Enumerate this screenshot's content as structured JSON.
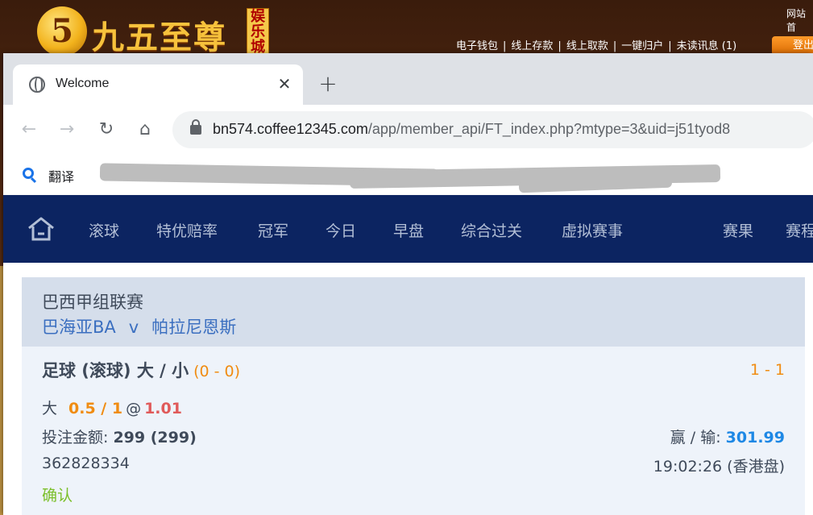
{
  "background_site": {
    "logo_glyph": "5",
    "title": "九五至尊",
    "badge": "娱乐城",
    "links": [
      "电子钱包",
      "线上存款",
      "线上取款",
      "一键归户",
      "未读讯息 (1)"
    ],
    "corner_text": "网站首",
    "login_label": "登出"
  },
  "browser": {
    "tab_title": "Welcome",
    "close_glyph": "✕",
    "new_tab_glyph": "+",
    "url_host": "bn574.coffee12345.com",
    "url_path": "/app/member_api/FT_index.php?mtype=3&uid=j51tyod8",
    "bookmark_label": "翻译"
  },
  "sport_nav": {
    "items": [
      "滚球",
      "特优赔率",
      "冠军",
      "今日",
      "早盘",
      "综合过关",
      "虚拟赛事"
    ],
    "right_items": [
      "赛果",
      "赛程"
    ]
  },
  "match": {
    "league": "巴西甲组联赛",
    "home": "巴海亚BA",
    "vs": "v",
    "away": "帕拉尼恩斯"
  },
  "bet": {
    "title": "足球 (滚球) 大 / 小",
    "score_at_bet": "(0 - 0)",
    "live_score": "1 - 1",
    "selection": "大",
    "line": "0.5 / 1",
    "at": "@",
    "odds": "1.01",
    "stake_label": "投注金额:",
    "stake_value": "299 (299)",
    "winloss_label": "赢 / 输:",
    "winloss_value": "301.99",
    "ticket_id": "362828334",
    "time": "19:02:26 (香港盘)",
    "status": "确认"
  },
  "colors": {
    "nav_bg": "#0c2461",
    "accent_orange": "#f08c12",
    "odds_red": "#e05a5a",
    "win_blue": "#1e88e5",
    "confirm_green": "#7bbf2a"
  }
}
